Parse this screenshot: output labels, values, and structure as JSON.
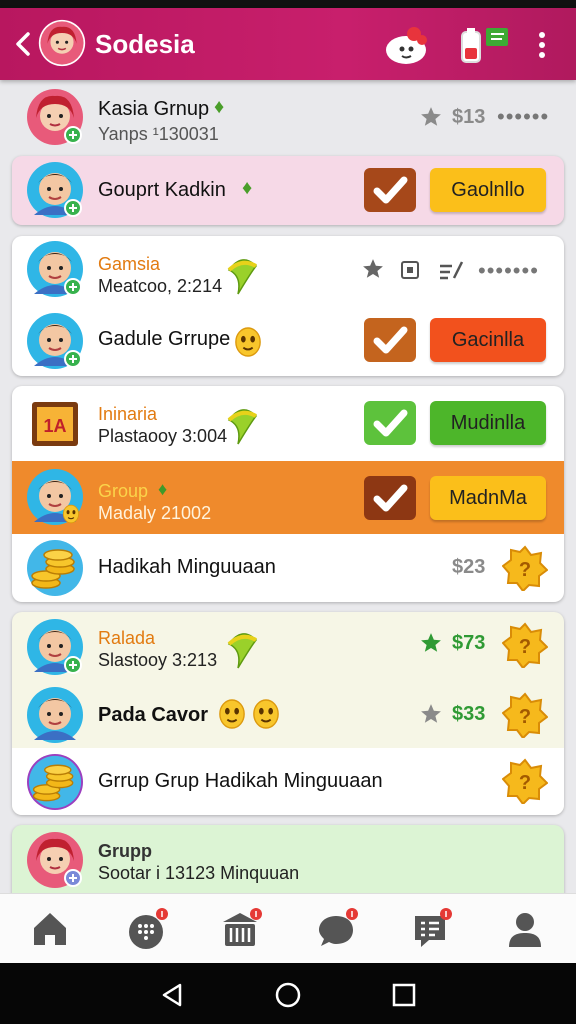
{
  "header": {
    "title": "Sodesia"
  },
  "list": [
    {
      "name": "Kasia Grnup",
      "subtitle": "Yanps ¹130031",
      "price": "$13",
      "more": "••••••"
    },
    {
      "name": "Gouprt Kadkin",
      "action": "Gaolnllo"
    },
    {
      "name": "Gamsia",
      "subtitle": "Meatcoo, 2:214",
      "more": "•••••••"
    },
    {
      "name": "Gadule Grrupe",
      "action": "Gacinlla"
    },
    {
      "name": "Ininaria",
      "subtitle": "Plastaooy 3:004",
      "action": "Mudinlla"
    },
    {
      "name": "Group",
      "subtitle": "Madaly 21002",
      "action": "MadnMa"
    },
    {
      "name": "Hadikah Minguuaan",
      "price": "$23"
    },
    {
      "name": "Ralada",
      "subtitle": "Slastooy 3:213",
      "price": "$73"
    },
    {
      "name": "Pada Cavor",
      "price": "$33"
    },
    {
      "name": "Grrup Grup Hadikah Minguuaan"
    },
    {
      "name": "Grupp",
      "subtitle": "Sootar i 13123 Minquuan"
    }
  ],
  "colors": {
    "brand": "#c81f6c",
    "accent_orange": "#f39a1c",
    "accent_yellow": "#fbbf1a",
    "accent_red": "#f2511d",
    "accent_green": "#4db62a"
  },
  "icons": [
    "back-arrow-icon",
    "bubble-icon",
    "battery-icon",
    "more-vert-icon",
    "star-icon",
    "stop-icon",
    "sort-icon",
    "checkbox-icon",
    "smiley-icon",
    "gold-star-icon",
    "home-icon",
    "dialpad-icon",
    "bank-icon",
    "chat-icon",
    "messages-icon",
    "profile-icon"
  ]
}
